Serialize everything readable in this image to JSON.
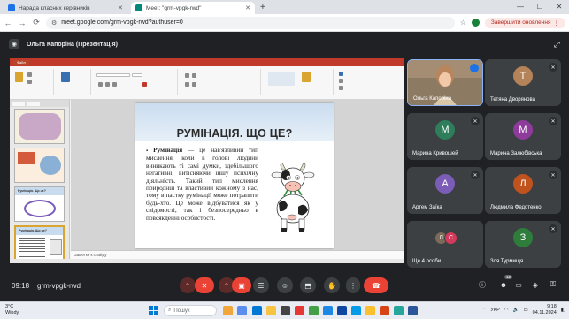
{
  "browser": {
    "tabs": [
      {
        "label": "Нарада класних керівників",
        "active": false
      },
      {
        "label": "Meet: \"grm-vpgk-rwd\"",
        "active": true
      }
    ],
    "url": "meet.google.com/grm-vpgk-rwd?authuser=0",
    "finish_update_label": "Завершити оновлення"
  },
  "meet_header": {
    "presenter_title": "Ольга Капоріна (Презентація)"
  },
  "presentation": {
    "ribbon_first_tab": "Файл",
    "slide_title": "РУМІНАЦІЯ. ЩО ЦЕ?",
    "slide_term": "Румінація",
    "slide_text": " — це нав'язливий тип мислення, коли в голові людини виникають ті самі думки, здебільшого негативні, витісняючи іншу психічну діяльність. Такий тип мислення природній та властивий кожному з нас, тому в пастку румінації може потрапити будь-хто. Це може відбуватися як у свідомості, так і безпосередньо в повсякденні особистості.",
    "notes_placeholder": "Заметки к слайду",
    "thumb_numbers": [
      "1",
      "2",
      "3",
      "4",
      "5"
    ],
    "thumb_captions": [
      "",
      "",
      "Румінація. Що це?",
      "",
      "Румінація. Що це?"
    ]
  },
  "participants": [
    {
      "name": "Ольга Капоріна",
      "initial": "",
      "color": "#5a4a3c",
      "video": true
    },
    {
      "name": "Тетяна Дворянова",
      "initial": "Т",
      "color": "#b5835a"
    },
    {
      "name": "Марина Кривошей",
      "initial": "М",
      "color": "#2e7d5b"
    },
    {
      "name": "Марина Залюбівська",
      "initial": "М",
      "color": "#8e3b9c"
    },
    {
      "name": "Артем Заїка",
      "initial": "А",
      "color": "#7b5cb7"
    },
    {
      "name": "Людмила Федотенко",
      "initial": "Л",
      "color": "#c0521e"
    },
    {
      "name": "Ще 4 особи",
      "initials": [
        "Л",
        "С"
      ],
      "colors": [
        "#7c6a5a",
        "#d33a5c"
      ]
    },
    {
      "name": "Зоя Турмищя",
      "initial": "З",
      "color": "#2e7d3b"
    }
  ],
  "controls": {
    "time": "09:18",
    "meeting_code": "grm-vpgk-rwd",
    "participants_count": "12"
  },
  "taskbar": {
    "weather_temp": "3°C",
    "weather_desc": "Windy",
    "search_placeholder": "Пошук",
    "language": "УКР",
    "time": "9:18",
    "date": "04.11.2024"
  }
}
